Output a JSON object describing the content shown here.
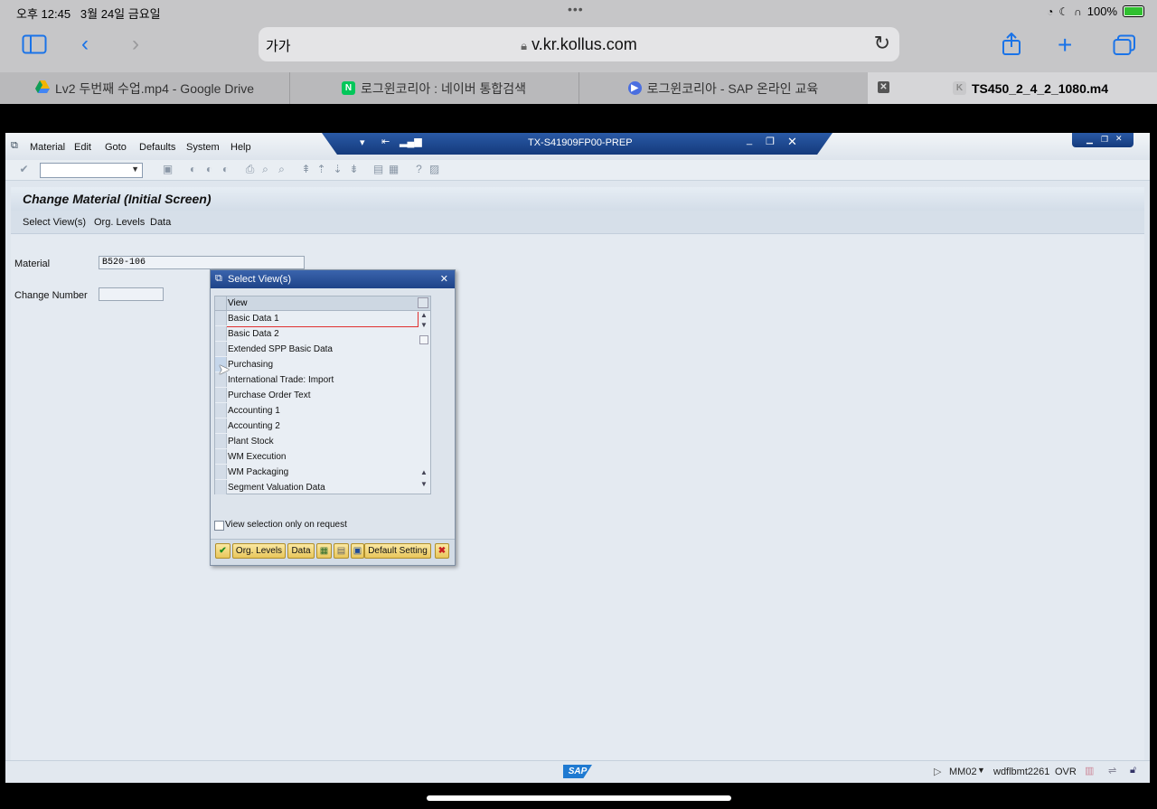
{
  "status_bar": {
    "time": "오후 12:45",
    "date": "3월 24일 금요일",
    "battery": "100%"
  },
  "browser": {
    "aa_label": "가가",
    "url": "v.kr.kollus.com",
    "tabs": [
      {
        "label": "Lv2 두번째 수업.mp4 - Google Drive"
      },
      {
        "label": "로그윈코리아 : 네이버 통합검색",
        "favicon": "N"
      },
      {
        "label": "로그윈코리아 - SAP 온라인 교육"
      },
      {
        "label": "TS450_2_4_2_1080.m4",
        "favicon": "K"
      }
    ]
  },
  "sap": {
    "menu": [
      "Material",
      "Edit",
      "Goto",
      "Defaults",
      "System",
      "Help"
    ],
    "system_title": "TX-S41909FP00-PREP",
    "screen_title": "Change Material (Initial Screen)",
    "app_toolbar": [
      "Select View(s)",
      "Org. Levels",
      "Data"
    ],
    "fields": {
      "material_label": "Material",
      "material_value": "B520-106",
      "change_number_label": "Change Number",
      "change_number_value": ""
    },
    "footer": {
      "transaction": "MM02",
      "server": "wdflbmt2261",
      "mode": "OVR",
      "logo": "SAP"
    }
  },
  "dialog": {
    "title": "Select View(s)",
    "column_header": "View",
    "views": [
      "Basic Data 1",
      "Basic Data 2",
      "Extended SPP Basic Data",
      "Purchasing",
      "International Trade: Import",
      "Purchase Order Text",
      "Accounting 1",
      "Accounting 2",
      "Plant Stock",
      "WM Execution",
      "WM Packaging",
      "Segment Valuation Data"
    ],
    "checkbox_label": "View selection only on request",
    "buttons": {
      "org_levels": "Org. Levels",
      "data": "Data",
      "default_setting": "Default Setting"
    }
  }
}
